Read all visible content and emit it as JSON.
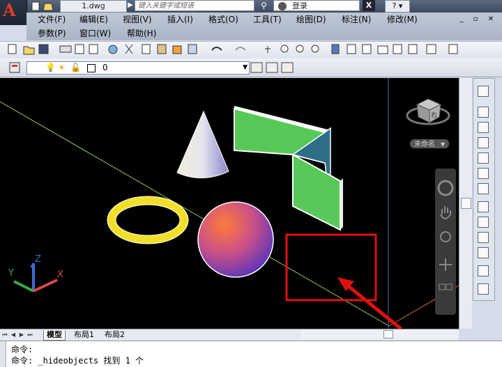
{
  "title_bar": {
    "file_tab": "1.dwg",
    "search_placeholder": "键入关键字或短语",
    "login_label": "登录",
    "exchange_label": "X",
    "help_label": "?"
  },
  "menu": {
    "row1": [
      "文件(F)",
      "编辑(E)",
      "视图(V)",
      "插入(I)",
      "格式(O)",
      "工具(T)",
      "绘图(D)",
      "标注(N)",
      "修改(M)"
    ],
    "row2": [
      "参数(P)",
      "窗口(W)",
      "帮助(H)"
    ]
  },
  "layer_bar": {
    "current_layer": "0"
  },
  "viewcube": {
    "face_label": "右",
    "ucs_dropdown": "未命名"
  },
  "ucs": {
    "x_label": "X",
    "y_label": "Y",
    "z_label": "Z"
  },
  "layout_tabs": [
    "模型",
    "布局1",
    "布局2"
  ],
  "command_line": {
    "lines": [
      "命令:",
      "命令: _hideobjects 找到 1 个"
    ]
  },
  "colors": {
    "canvas": "#000000",
    "highlight_box": "#e01010",
    "arrow": "#e01010",
    "cone": "#d8d8e8",
    "torus": "#f0e020",
    "sphere_top": "#ff7a3a",
    "sphere_bottom": "#5a3cc8",
    "panel_green": "#58c958",
    "panel_teal": "#2f6e88"
  }
}
